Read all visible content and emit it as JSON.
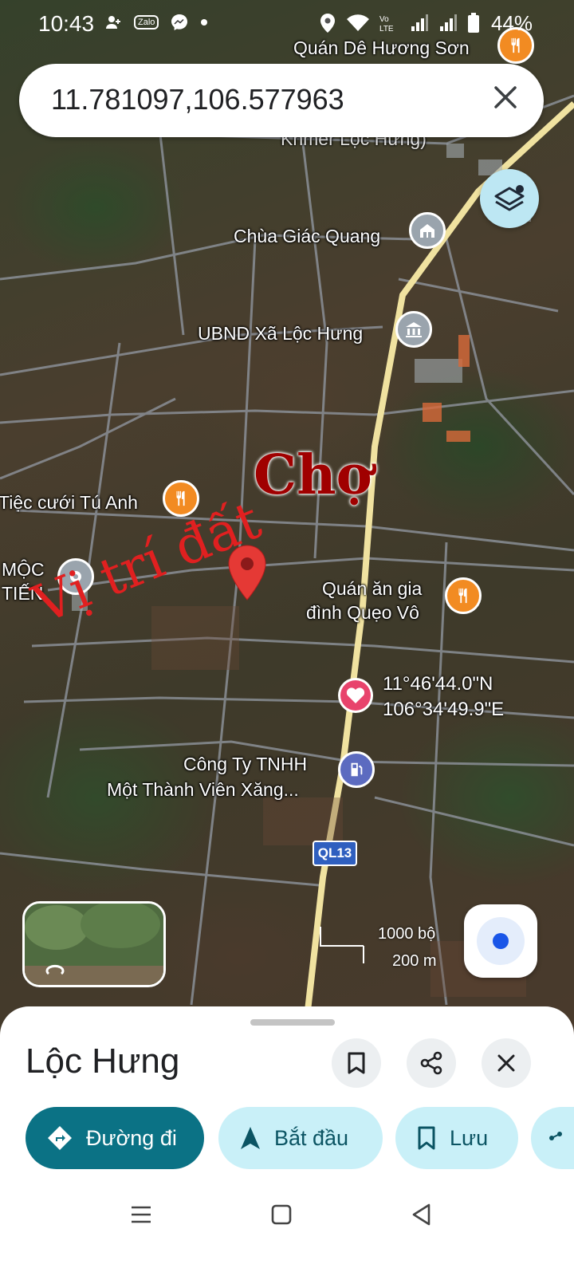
{
  "status_bar": {
    "time": "10:43",
    "battery": "44%",
    "app_badge": "Zalo"
  },
  "search": {
    "query": "11.781097,106.577963"
  },
  "map": {
    "pois": [
      {
        "name": "Quán Dê Hương Sơn",
        "icon": "restaurant-icon"
      },
      {
        "name": "Khmer Lộc Hưng)"
      },
      {
        "name": "Chùa Giác Quang",
        "icon": "temple-icon"
      },
      {
        "name": "UBND Xã Lộc Hưng",
        "icon": "government-building-icon"
      },
      {
        "name": "Tiệc cưới Tú Anh",
        "icon": "restaurant-icon"
      },
      {
        "name_line1": "MỘC",
        "name_line2": "TIẾN",
        "icon": "place-pin-icon"
      },
      {
        "name_line1": "Quán ăn gia",
        "name_line2": "đình Quẹo Vô",
        "icon": "restaurant-icon"
      },
      {
        "name_line1": "Công Ty TNHH",
        "name_line2": "Một Thành Viên Xăng...",
        "icon": "gas-station-icon"
      }
    ],
    "annotation_market": "Chợ",
    "annotation_land": "Vị trí đất",
    "pin_coords": {
      "lat": "11°46'44.0\"N",
      "lng": "106°34'49.9\"E"
    },
    "road_label": "QL13",
    "scale": {
      "imperial": "1000 bộ",
      "metric": "200 m"
    }
  },
  "sheet": {
    "title": "Lộc Hưng",
    "actions": [
      {
        "label": "Đường đi",
        "icon": "directions-icon"
      },
      {
        "label": "Bắt đầu",
        "icon": "navigation-arrow-icon"
      },
      {
        "label": "Lưu",
        "icon": "bookmark-icon"
      }
    ]
  },
  "colors": {
    "accent": "#0b7285",
    "chip_bg": "#c9f0f8",
    "pin": "#e53935",
    "poi_orange": "#f28b22",
    "poi_gray": "#9aa4ad",
    "poi_gas": "#5c6bc0"
  }
}
